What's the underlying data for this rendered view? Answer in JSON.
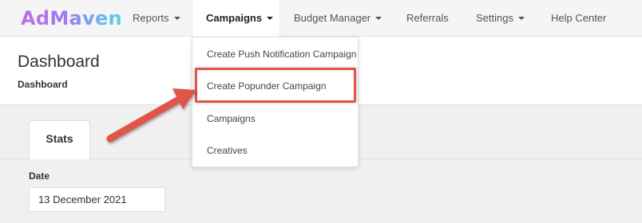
{
  "app": {
    "brand": "AdMaven"
  },
  "nav": {
    "items": [
      {
        "label": "Reports",
        "has_caret": true
      },
      {
        "label": "Campaigns",
        "has_caret": true,
        "active": true
      },
      {
        "label": "Budget Manager",
        "has_caret": true
      },
      {
        "label": "Referrals",
        "has_caret": false
      },
      {
        "label": "Settings",
        "has_caret": true
      },
      {
        "label": "Help Center",
        "has_caret": false
      }
    ]
  },
  "header": {
    "title": "Dashboard",
    "breadcrumb": "Dashboard"
  },
  "tabs": [
    {
      "label": "Stats",
      "active": true
    }
  ],
  "form": {
    "date_label": "Date",
    "date_value": "13 December 2021"
  },
  "dropdown": {
    "items": [
      {
        "label": "Create Push Notification Campaign"
      },
      {
        "label": "Create Popunder Campaign",
        "highlighted": true
      },
      {
        "label": "Campaigns"
      },
      {
        "label": "Creatives"
      }
    ]
  },
  "annotation": {
    "color": "#e0554a"
  },
  "colors": {
    "logo_gradient_start": "#c06ee8",
    "logo_gradient_end": "#4fd6e6",
    "navbar_bg": "#f5f5f5",
    "page_bg": "#f0f0f0"
  }
}
